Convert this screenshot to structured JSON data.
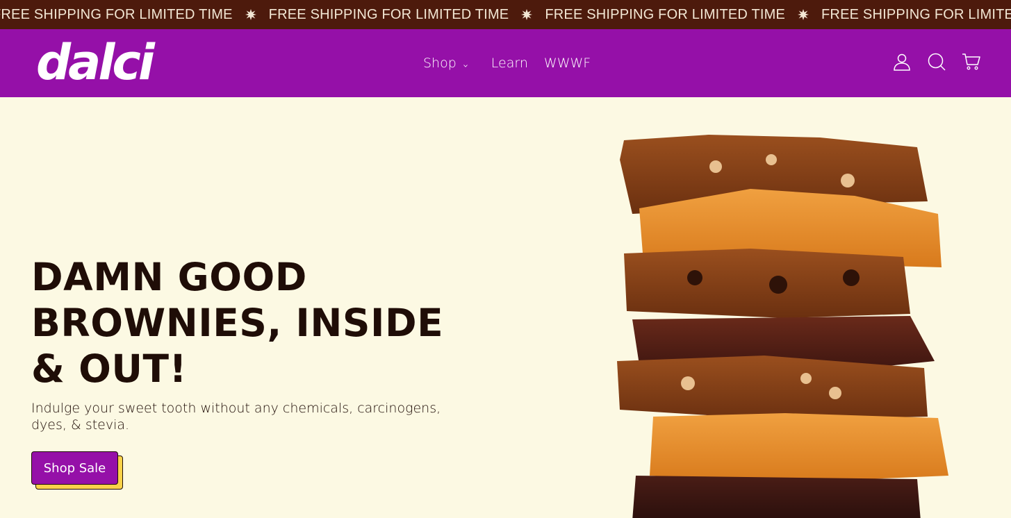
{
  "announcement": {
    "text": "FREE SHIPPING FOR LIMITED TIME",
    "repeat_count": 4,
    "background": "#4d1a0c",
    "text_color": "#f3e7d4"
  },
  "header": {
    "brand": "dalci",
    "background": "#9510a8",
    "nav": [
      {
        "label": "Shop",
        "has_dropdown": true
      },
      {
        "label": "Learn",
        "has_dropdown": false
      },
      {
        "label": "WWWF",
        "has_dropdown": false
      }
    ],
    "icons": [
      "account-icon",
      "search-icon",
      "cart-icon"
    ]
  },
  "hero": {
    "headline_lines": [
      "DAMN GOOD",
      "BROWNIES, INSIDE",
      "& OUT!"
    ],
    "subtext": "Indulge your sweet tooth without any chemicals, carcinogens, dyes, & stevia.",
    "cta_label": "Shop Sale",
    "background": "#fcf9e3",
    "accent": "#f9d24a"
  }
}
